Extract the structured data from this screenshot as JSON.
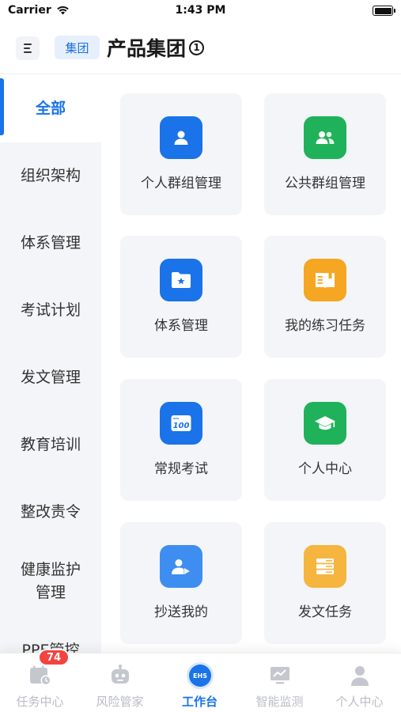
{
  "status_bar": {
    "carrier": "Carrier",
    "time": "1:43 PM"
  },
  "header": {
    "group_badge": "集团",
    "title": "产品集团",
    "info_symbol": "1"
  },
  "sidebar": {
    "items": [
      {
        "label": "全部",
        "active": true
      },
      {
        "label": "组织架构"
      },
      {
        "label": "体系管理"
      },
      {
        "label": "考试计划"
      },
      {
        "label": "发文管理"
      },
      {
        "label": "教育培训"
      },
      {
        "label": "整改责令"
      },
      {
        "label": "健康监护管理"
      },
      {
        "label": "PPE管控"
      }
    ]
  },
  "grid": {
    "cards": [
      {
        "label": "个人群组管理",
        "icon": "person-icon",
        "color": "#1a73e8"
      },
      {
        "label": "公共群组管理",
        "icon": "group-icon",
        "color": "#1fb25a"
      },
      {
        "label": "体系管理",
        "icon": "folder-star-icon",
        "color": "#1a73e8"
      },
      {
        "label": "我的练习任务",
        "icon": "book-icon",
        "color": "#f5a623"
      },
      {
        "label": "常规考试",
        "icon": "exam-100-icon",
        "color": "#1a73e8"
      },
      {
        "label": "个人中心",
        "icon": "graduation-cap-icon",
        "color": "#1fb25a"
      },
      {
        "label": "抄送我的",
        "icon": "person-forward-icon",
        "color": "#3d8ef0"
      },
      {
        "label": "发文任务",
        "icon": "document-stack-icon",
        "color": "#f5b53f"
      }
    ]
  },
  "tabbar": {
    "tabs": [
      {
        "label": "任务中心",
        "icon": "task-calendar-icon",
        "badge": "74"
      },
      {
        "label": "风险管家",
        "icon": "robot-icon"
      },
      {
        "label": "工作台",
        "icon": "ehs-icon",
        "icon_text": "EHS",
        "active": true
      },
      {
        "label": "智能监测",
        "icon": "monitor-chart-icon"
      },
      {
        "label": "个人中心",
        "icon": "user-icon"
      }
    ]
  }
}
